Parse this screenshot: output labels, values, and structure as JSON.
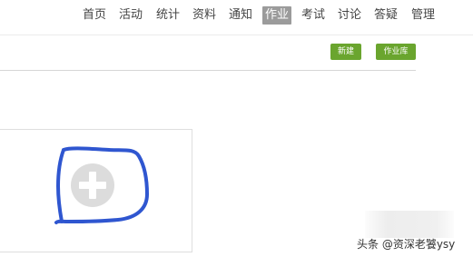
{
  "nav": {
    "items": [
      {
        "label": "首页",
        "active": false
      },
      {
        "label": "活动",
        "active": false
      },
      {
        "label": "统计",
        "active": false
      },
      {
        "label": "资料",
        "active": false
      },
      {
        "label": "通知",
        "active": false
      },
      {
        "label": "作业",
        "active": true
      },
      {
        "label": "考试",
        "active": false
      },
      {
        "label": "讨论",
        "active": false
      },
      {
        "label": "答疑",
        "active": false
      },
      {
        "label": "管理",
        "active": false
      }
    ]
  },
  "toolbar": {
    "new_label": "新建",
    "library_label": "作业库"
  },
  "card": {
    "add_icon": "plus-circle-icon"
  },
  "annotation": {
    "color": "#2f56d0"
  },
  "watermark": {
    "text": "头条 @资深老饕ysy"
  },
  "colors": {
    "button_green": "#6aa52e",
    "active_tab_bg": "#9b9b9b"
  }
}
